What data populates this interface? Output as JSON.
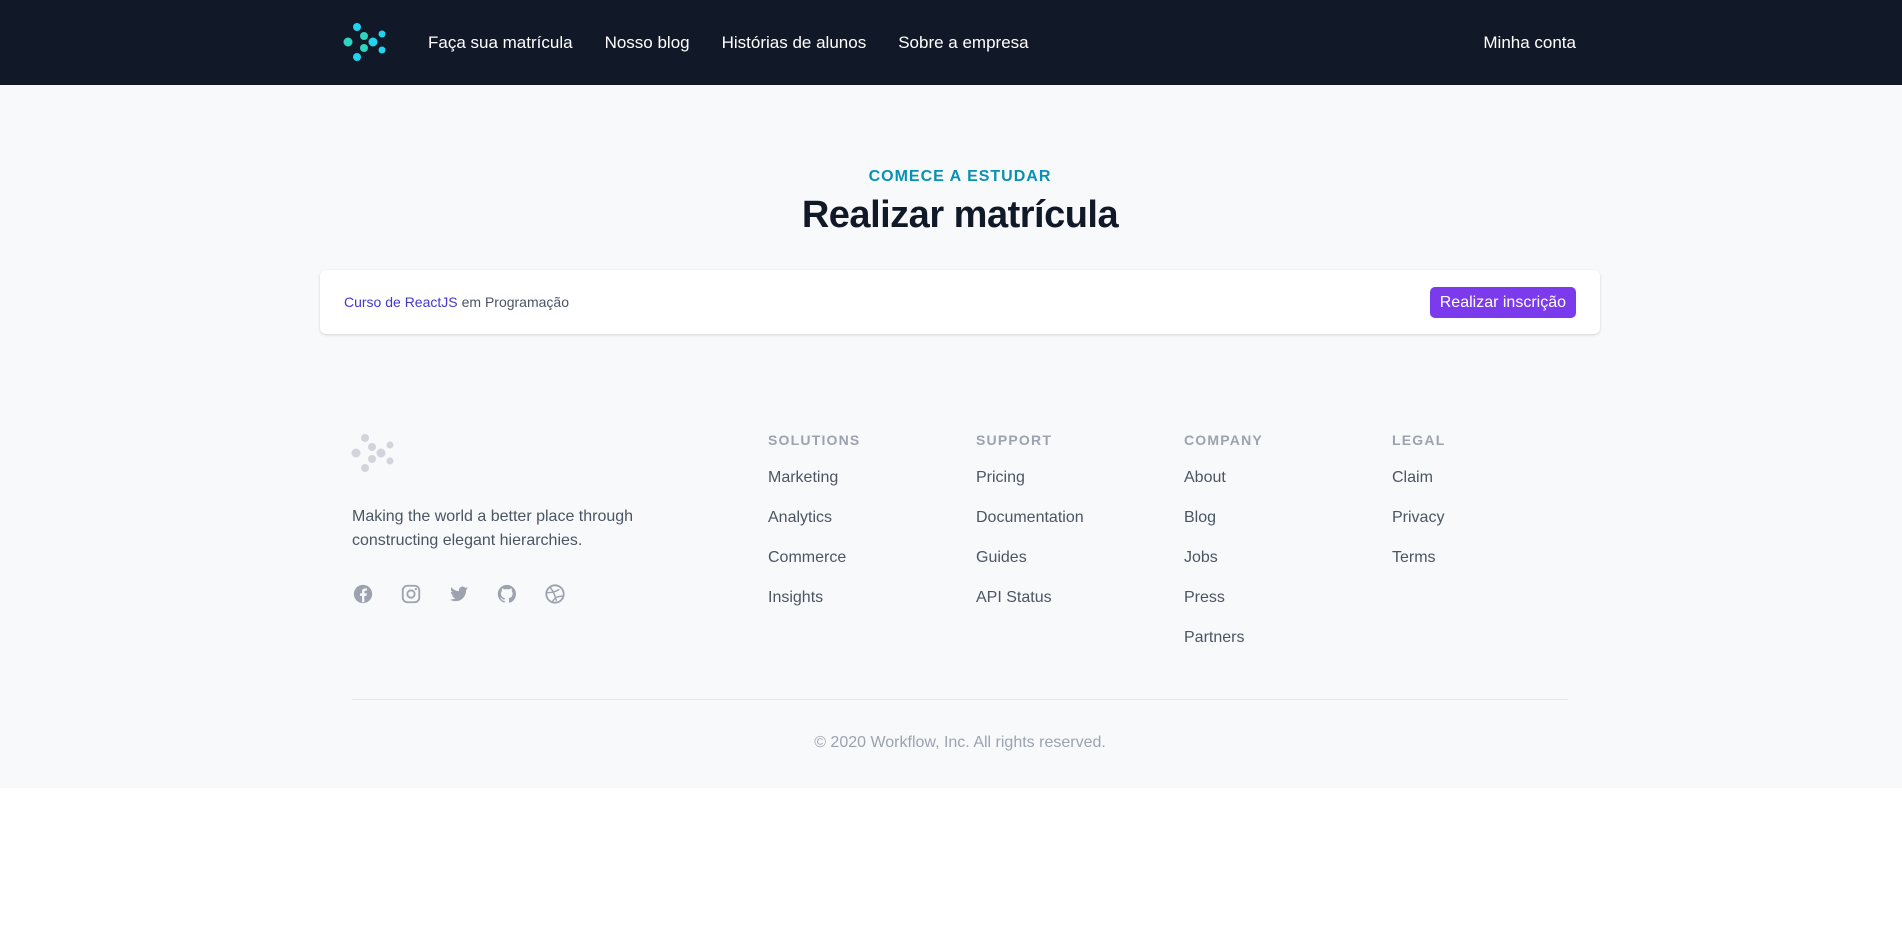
{
  "header": {
    "nav": [
      "Faça sua matrícula",
      "Nosso blog",
      "Histórias de alunos",
      "Sobre a empresa"
    ],
    "account": "Minha conta"
  },
  "hero": {
    "eyebrow": "COMECE A ESTUDAR",
    "title": "Realizar matrícula"
  },
  "enrollment": {
    "course_name": "Curso de ReactJS",
    "course_category": "em Programação",
    "button_label": "Realizar inscrição"
  },
  "footer": {
    "tagline": "Making the world a better place through constructing elegant hierarchies.",
    "socials": [
      "facebook-icon",
      "instagram-icon",
      "twitter-icon",
      "github-icon",
      "dribbble-icon"
    ],
    "columns": [
      {
        "title": "SOLUTIONS",
        "links": [
          "Marketing",
          "Analytics",
          "Commerce",
          "Insights"
        ]
      },
      {
        "title": "SUPPORT",
        "links": [
          "Pricing",
          "Documentation",
          "Guides",
          "API Status"
        ]
      },
      {
        "title": "COMPANY",
        "links": [
          "About",
          "Blog",
          "Jobs",
          "Press",
          "Partners"
        ]
      },
      {
        "title": "LEGAL",
        "links": [
          "Claim",
          "Privacy",
          "Terms"
        ]
      }
    ],
    "copyright": "© 2020 Workflow, Inc. All rights reserved."
  },
  "colors": {
    "header_bg": "#111827",
    "accent_cyan": "#0891b2",
    "button_purple": "#7c3aed",
    "link_indigo": "#4338ca"
  }
}
